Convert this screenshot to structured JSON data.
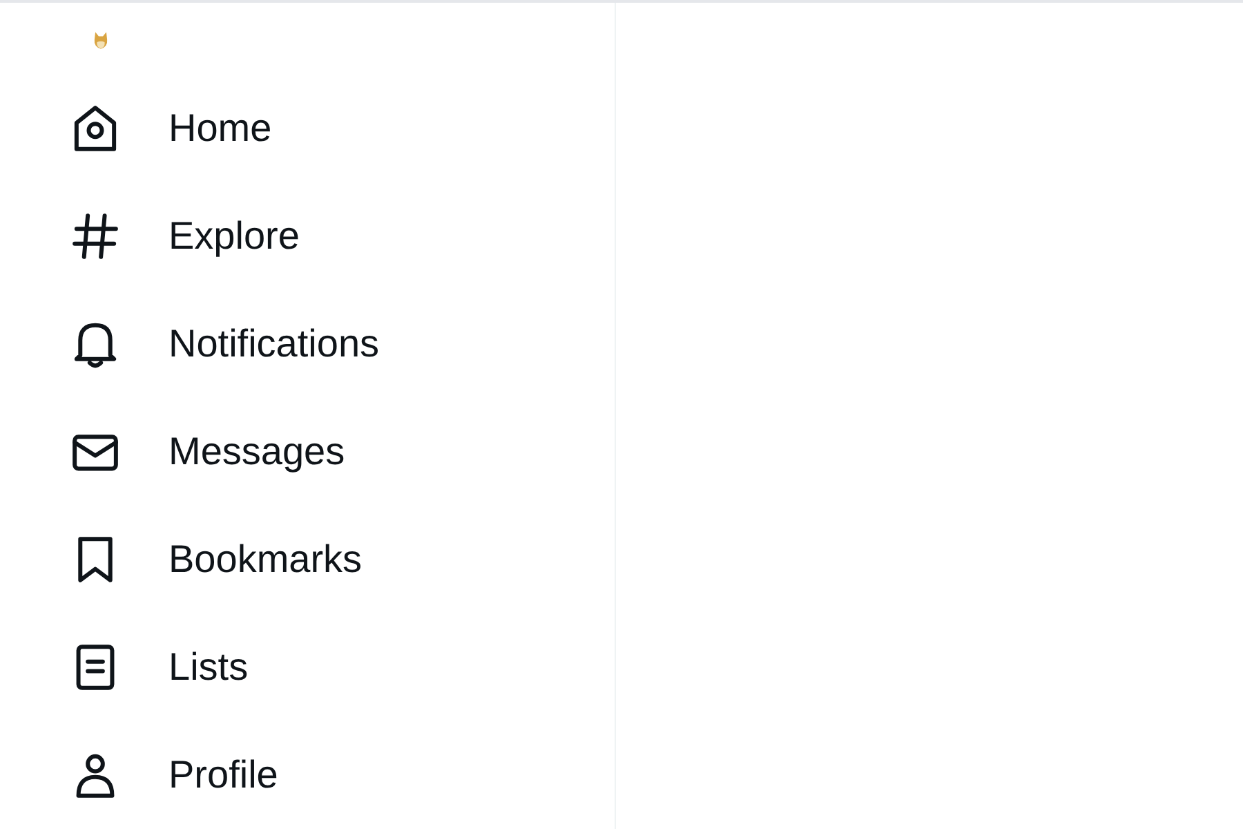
{
  "nav": [
    {
      "label": "Home"
    },
    {
      "label": "Explore"
    },
    {
      "label": "Notifications"
    },
    {
      "label": "Messages"
    },
    {
      "label": "Bookmarks"
    },
    {
      "label": "Lists"
    },
    {
      "label": "Profile"
    }
  ]
}
